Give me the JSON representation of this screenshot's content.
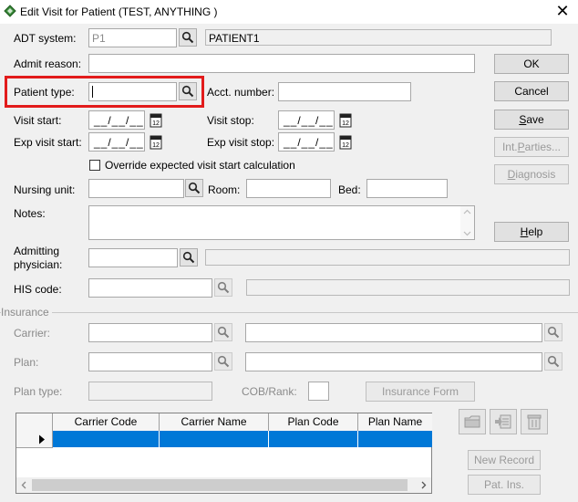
{
  "window": {
    "title": "Edit Visit for Patient (TEST, ANYTHING )",
    "close_glyph": "✕"
  },
  "form": {
    "adt_system": {
      "label": "ADT system:",
      "code": "P1",
      "name": "PATIENT1"
    },
    "admit_reason": {
      "label": "Admit reason:",
      "value": ""
    },
    "patient_type": {
      "label": "Patient type:",
      "value": ""
    },
    "acct_number": {
      "label": "Acct. number:",
      "value": ""
    },
    "visit_start": {
      "label": "Visit start:",
      "value": "__/__/__"
    },
    "visit_stop": {
      "label": "Visit stop:",
      "value": "__/__/__"
    },
    "exp_visit_start": {
      "label": "Exp visit start:",
      "value": "__/__/__"
    },
    "exp_visit_stop": {
      "label": "Exp visit stop:",
      "value": "__/__/__"
    },
    "override_checkbox": {
      "label": "Override expected visit start calculation",
      "checked": false
    },
    "nursing_unit": {
      "label": "Nursing unit:",
      "value": ""
    },
    "room": {
      "label": "Room:",
      "value": ""
    },
    "bed": {
      "label": "Bed:",
      "value": ""
    },
    "notes": {
      "label": "Notes:",
      "value": ""
    },
    "admitting_physician": {
      "label_line1": "Admitting",
      "label_line2": "physician:",
      "value": ""
    },
    "his_code": {
      "label": "HIS code:",
      "value": ""
    }
  },
  "buttons": {
    "ok": "OK",
    "cancel": "Cancel",
    "save_u": "S",
    "save_rest": "ave",
    "int_parties_pre": "Int. ",
    "int_parties_u": "P",
    "int_parties_rest": "arties...",
    "diagnosis_u": "D",
    "diagnosis_rest": "iagnosis",
    "help_u": "H",
    "help_rest": "elp",
    "new_record": "New Record",
    "pat_ins": "Pat. Ins."
  },
  "insurance": {
    "section_label": "Insurance",
    "carrier_label": "Carrier:",
    "plan_label": "Plan:",
    "plan_type_label": "Plan type:",
    "cob_rank_label": "COB/Rank:",
    "insurance_form_button": "Insurance Form",
    "grid": {
      "columns": [
        "Carrier Code",
        "Carrier Name",
        "Plan Code",
        "Plan Name"
      ]
    }
  },
  "colors": {
    "highlight_box": "#e21b1b",
    "selected_row": "#0078d7"
  }
}
